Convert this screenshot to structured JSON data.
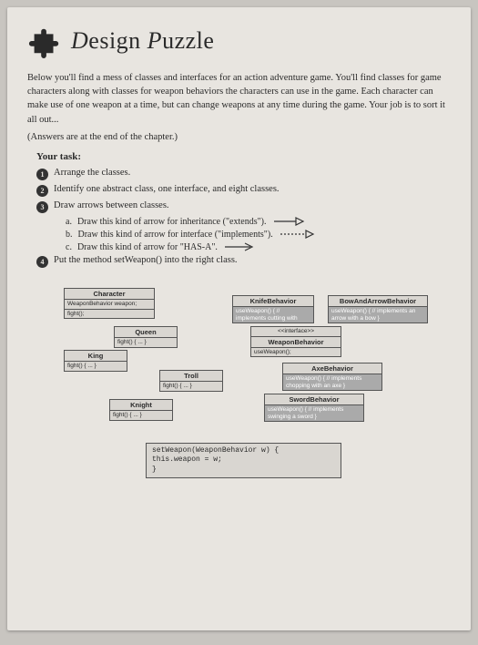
{
  "header": {
    "title_part1": "D",
    "title_part2": "esign ",
    "title_part3": "P",
    "title_part4": "uzzle"
  },
  "intro": "Below you'll find a mess of classes and interfaces for an action adventure game. You'll find classes for game characters along with classes for weapon behaviors the characters can use in the game. Each character can make use of one weapon at a time, but can change weapons at any time during the game. Your job is to sort it all out...",
  "answers_note": "(Answers are at the end of the chapter.)",
  "task_title": "Your task:",
  "tasks": [
    {
      "n": "1",
      "text": "Arrange the classes."
    },
    {
      "n": "2",
      "text": "Identify one abstract class, one interface, and eight classes."
    },
    {
      "n": "3",
      "text": "Draw arrows between classes."
    },
    {
      "n": "4",
      "text": "Put the method setWeapon() into the right class."
    }
  ],
  "subtasks": [
    {
      "label": "a.",
      "text": "Draw this kind of arrow for inheritance (\"extends\")."
    },
    {
      "label": "b.",
      "text": "Draw this kind of arrow for interface (\"implements\")."
    },
    {
      "label": "c.",
      "text": "Draw this kind of arrow for \"HAS-A\"."
    }
  ],
  "uml": {
    "character": {
      "title": "Character",
      "body1": "WeaponBehavior weapon;",
      "body2": "fight();"
    },
    "queen": {
      "title": "Queen",
      "body": "fight() { ... }"
    },
    "king": {
      "title": "King",
      "body": "fight() { ... }"
    },
    "troll": {
      "title": "Troll",
      "body": "fight() { ... }"
    },
    "knight": {
      "title": "Knight",
      "body": "fight() { ... }"
    },
    "knife": {
      "title": "KnifeBehavior",
      "body": "useWeapon() { // implements cutting with"
    },
    "bow": {
      "title": "BowAndArrowBehavior",
      "body": "useWeapon() { // implements an arrow with a bow }"
    },
    "weaponbeh": {
      "stereo": "<<interface>>",
      "title": "WeaponBehavior",
      "body": "useWeapon();"
    },
    "axe": {
      "title": "AxeBehavior",
      "body": "useWeapon() { // implements chopping with an axe }"
    },
    "sword": {
      "title": "SwordBehavior",
      "body": "useWeapon() { // implements swinging a sword }"
    }
  },
  "code": {
    "line1": "setWeapon(WeaponBehavior w) {",
    "line2": "    this.weapon = w;",
    "line3": "}"
  }
}
